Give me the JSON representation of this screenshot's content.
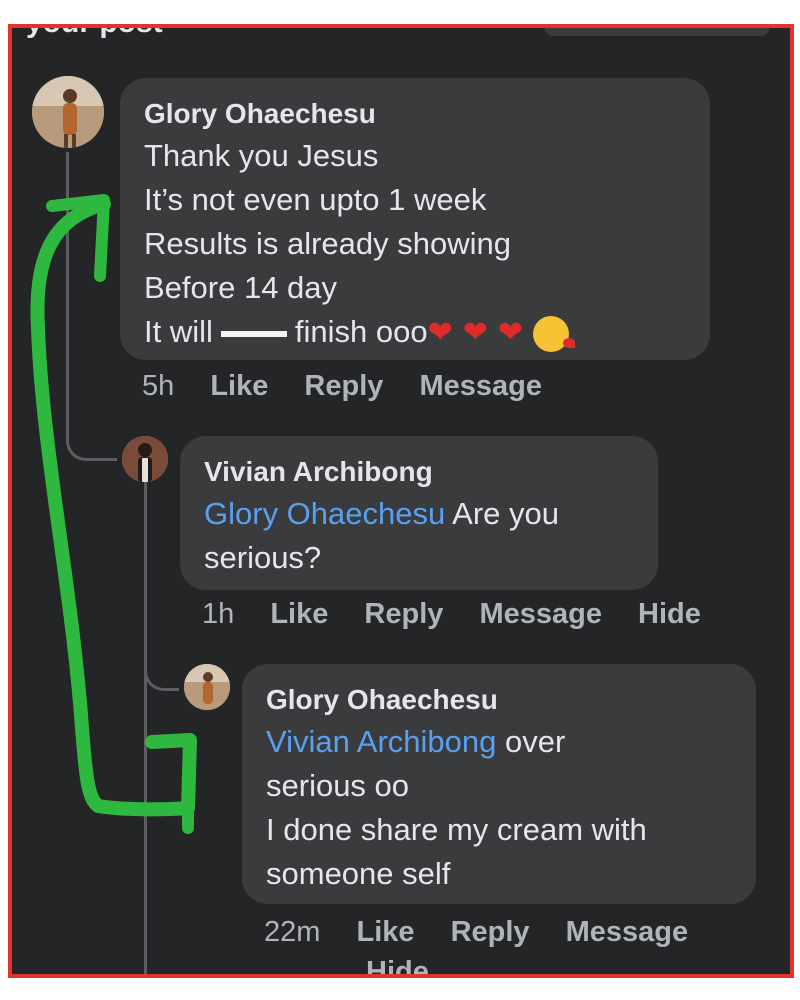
{
  "header": {
    "cut_text": "your post"
  },
  "comments": [
    {
      "author": "Glory Ohaechesu",
      "lines": [
        "Thank you Jesus",
        "It’s not even upto 1 week",
        "Results is already showing",
        "Before 14 day"
      ],
      "last_line_start": "It will",
      "last_line_end": "finish ooo",
      "emojis": [
        "red-heart",
        "red-heart",
        "red-heart",
        "face-blowing-kiss"
      ],
      "time": "5h",
      "actions": [
        "Like",
        "Reply",
        "Message"
      ]
    },
    {
      "author": "Vivian Archibong",
      "mention": "Glory Ohaechesu",
      "text_after_mention": "Are you",
      "line2": "serious?",
      "time": "1h",
      "actions": [
        "Like",
        "Reply",
        "Message",
        "Hide"
      ]
    },
    {
      "author": "Glory Ohaechesu",
      "mention": "Vivian Archibong",
      "text_after_mention": "over",
      "lines": [
        "serious oo",
        "I done share my cream with",
        "someone self"
      ],
      "time": "22m",
      "actions": [
        "Like",
        "Reply",
        "Message",
        "Hide"
      ]
    }
  ],
  "colors": {
    "background": "#242526",
    "bubble": "#3a3b3c",
    "text": "#e4e6eb",
    "mention": "#5aa0f0",
    "meta": "#b0b3b8",
    "frame_border": "#e5322b",
    "annotation_arrow": "#2fb83f"
  }
}
